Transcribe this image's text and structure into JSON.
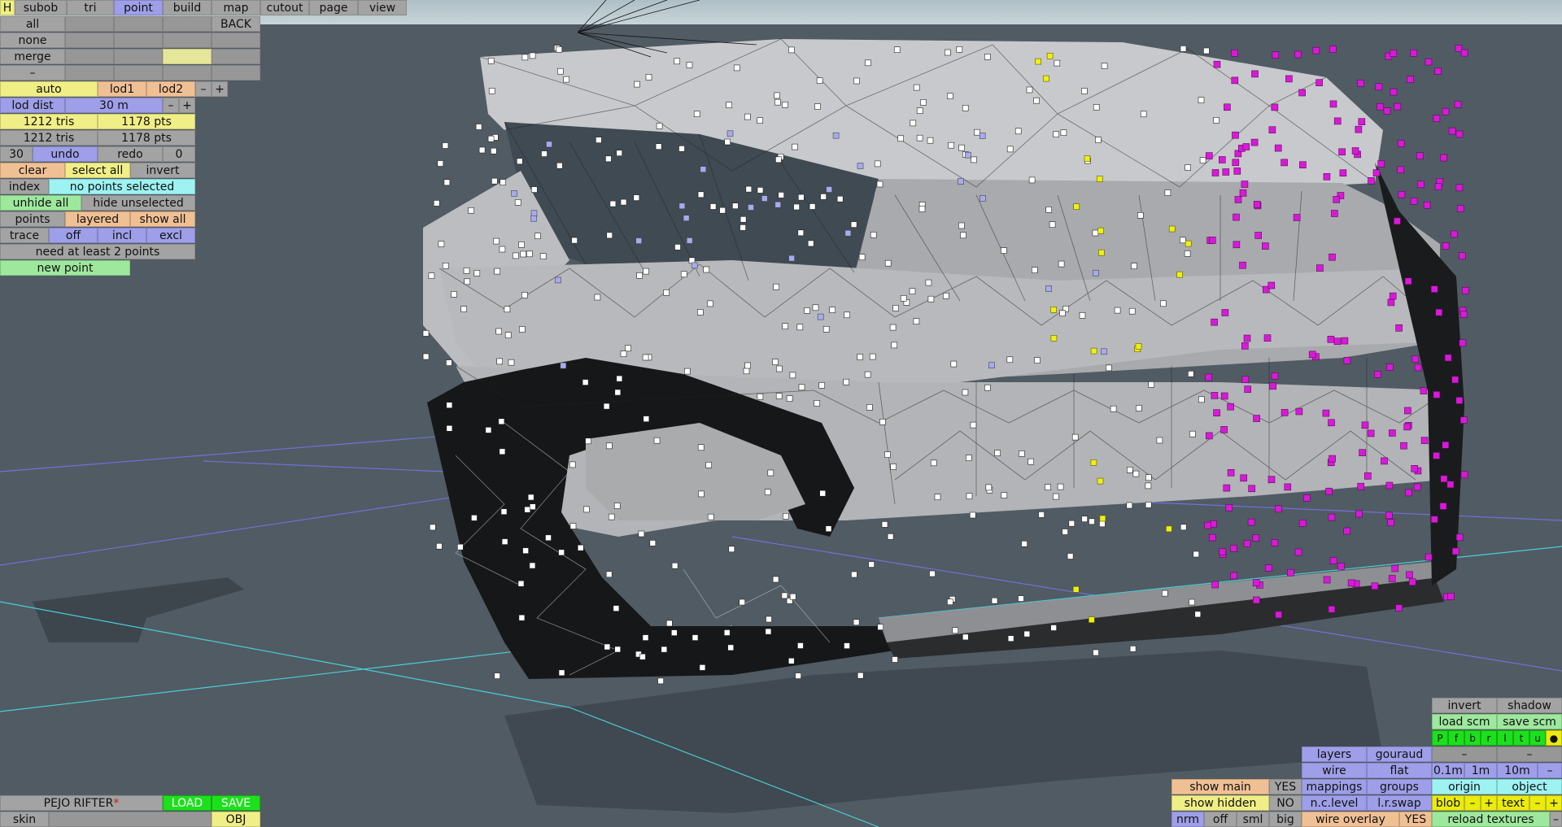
{
  "toolbar": {
    "h": "H",
    "subob": "subob",
    "tri": "tri",
    "point": "point",
    "build": "build",
    "map": "map",
    "cutout": "cutout",
    "page": "page",
    "view": "view"
  },
  "select_panel": {
    "all": "all",
    "none": "none",
    "merge": "merge",
    "dash": "–",
    "back": "BACK"
  },
  "lod": {
    "auto": "auto",
    "lod1": "lod1",
    "lod2": "lod2",
    "minus": "–",
    "plus": "+",
    "lod_dist_label": "lod dist",
    "lod_dist_value": "30 m"
  },
  "stats": {
    "tris1": "1212 tris",
    "pts1": "1178 pts",
    "tris2": "1212 tris",
    "pts2": "1178 pts"
  },
  "history": {
    "count": "30",
    "undo": "undo",
    "redo": "redo",
    "redo_count": "0"
  },
  "selection": {
    "clear": "clear",
    "select_all": "select all",
    "invert": "invert",
    "index": "index",
    "status": "no points selected",
    "unhide_all": "unhide all",
    "hide_unselected": "hide unselected",
    "points": "points",
    "layered": "layered",
    "show_all": "show all"
  },
  "trace": {
    "label": "trace",
    "off": "off",
    "incl": "incl",
    "excl": "excl"
  },
  "message": "need at least 2 points",
  "new_point": "new point",
  "file": {
    "name": "PEJO RIFTER",
    "modified_marker": "*",
    "load": "LOAD",
    "save": "SAVE",
    "skin": "skin",
    "obj": "OBJ"
  },
  "display_left": {
    "show_main": "show main",
    "show_main_val": "YES",
    "show_hidden": "show hidden",
    "show_hidden_val": "NO",
    "nrm": "nrm",
    "off": "off",
    "sml": "sml",
    "big": "big"
  },
  "display_mid": {
    "layers": "layers",
    "gouraud": "gouraud",
    "wire": "wire",
    "flat": "flat",
    "mappings": "mappings",
    "groups": "groups",
    "nclevel": "n.c.level",
    "lrswap": "l.r.swap",
    "wire_overlay": "wire overlay",
    "wire_overlay_val": "YES"
  },
  "display_right": {
    "invert": "invert",
    "shadow": "shadow",
    "load_scm": "load scm",
    "save_scm": "save scm",
    "letters": [
      "P",
      "f",
      "b",
      "r",
      "l",
      "t",
      "u",
      "●"
    ],
    "dash1": "–",
    "dash2": "–",
    "g01": "0.1m",
    "g1": "1m",
    "g10": "10m",
    "gminus": "–",
    "origin": "origin",
    "object": "object",
    "blob": "blob",
    "text": "text",
    "minus": "–",
    "plus": "+",
    "reload": "reload textures"
  },
  "colors": {
    "background": "#515b64",
    "active_tab": "#9e9fe8",
    "selected_point": "#d81ad8",
    "highlight_point": "#f0f010"
  }
}
